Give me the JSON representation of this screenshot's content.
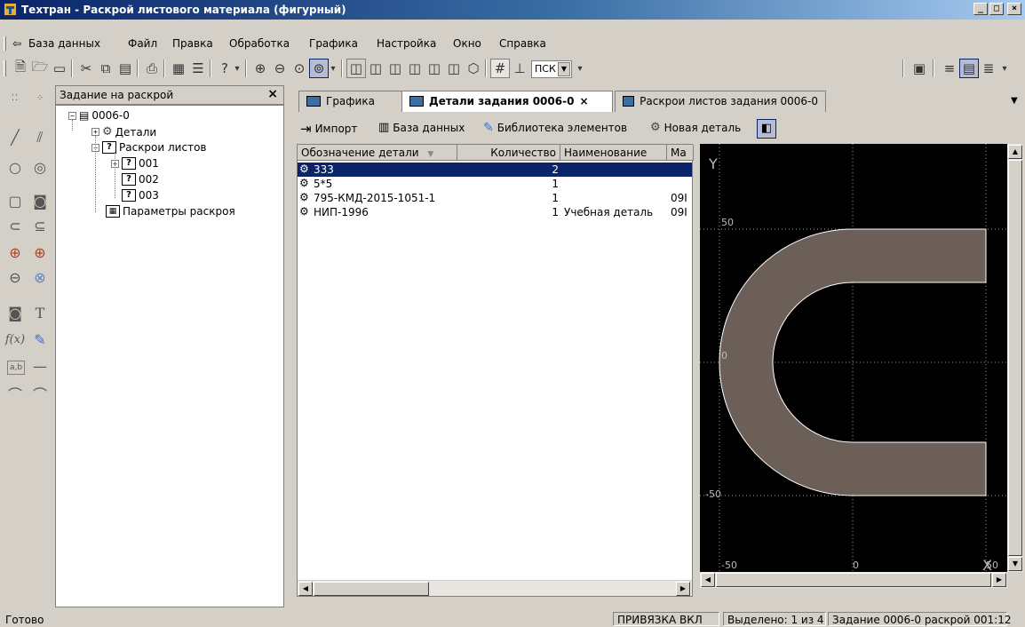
{
  "window": {
    "title": "Техтран - Раскрой листового материала (фигурный)",
    "min": "_",
    "max": "□",
    "close": "×"
  },
  "menu": {
    "items": [
      "База данных",
      "Файл",
      "Правка",
      "Обработка",
      "Графика",
      "Настройка",
      "Окно",
      "Справка"
    ],
    "back_icon": "back-arrow-icon"
  },
  "toolbar": {
    "coord_select": "ПСК"
  },
  "tree": {
    "header": "Задание на раскрой",
    "close": "×",
    "root": "0006-0",
    "details": "Детали",
    "sheets": "Раскрои листов",
    "sheet_items": [
      "001",
      "002",
      "003"
    ],
    "params": "Параметры раскроя"
  },
  "tabs": [
    {
      "label": "Графика",
      "active": false
    },
    {
      "label": "Детали задания 0006-0",
      "active": true,
      "close": "×"
    },
    {
      "label": "Раскрои листов задания 0006-0",
      "active": false
    }
  ],
  "subtoolbar": {
    "import": "Импорт",
    "database": "База данных",
    "library": "Библиотека элементов",
    "new_part": "Новая деталь"
  },
  "table": {
    "columns": [
      "Обозначение детали",
      "Количество",
      "Наименование",
      "Ма"
    ],
    "rows": [
      {
        "name": "333",
        "qty": "2",
        "title": "",
        "mat": "",
        "selected": true
      },
      {
        "name": "5*5",
        "qty": "1",
        "title": "",
        "mat": "",
        "selected": false
      },
      {
        "name": "795-КМД-2015-1051-1",
        "qty": "1",
        "title": "",
        "mat": "09I",
        "selected": false
      },
      {
        "name": "НИП-1996",
        "qty": "1",
        "title": "Учебная деталь",
        "mat": "09I",
        "selected": false
      }
    ]
  },
  "preview": {
    "y_axis": "Y",
    "x_axis": "X",
    "labels": {
      "y50": "50",
      "y0": "0",
      "ym50": "-50",
      "xm50": "-50",
      "x0": "0",
      "x50": "50"
    },
    "shape_fill": "#6b5f58"
  },
  "status": {
    "ready": "Готово",
    "snap": "ПРИВЯЗКА ВКЛ",
    "selected": "Выделено: 1 из 4",
    "task": "Задание 0006-0 раскрой 001:12"
  }
}
